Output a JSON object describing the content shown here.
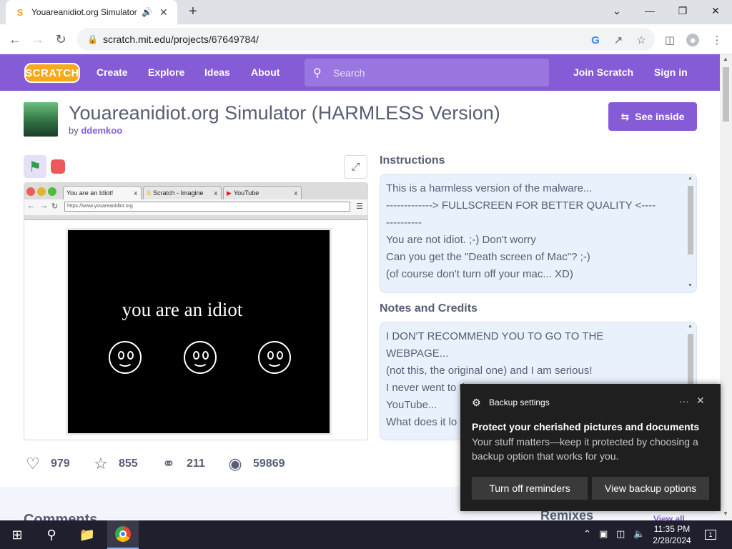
{
  "browser": {
    "tab_title": "Youareanidiot.org Simulator",
    "url": "scratch.mit.edu/projects/67649784/",
    "new_tab": "+"
  },
  "nav": {
    "logo": "SCRATCH",
    "links": [
      "Create",
      "Explore",
      "Ideas",
      "About"
    ],
    "search_placeholder": "Search",
    "join": "Join Scratch",
    "signin": "Sign in"
  },
  "project": {
    "title": "Youareanidiot.org Simulator (HARMLESS Version)",
    "by_label": "by",
    "author": "ddemkoo",
    "see_inside": "See inside"
  },
  "stage": {
    "tabs": [
      "You are an Idiot!",
      "Scratch - Imagine",
      "YouTube"
    ],
    "url": "https://www.youareanidiot.org",
    "message": "you are an idiot"
  },
  "instructions": {
    "heading": "Instructions",
    "lines": [
      "This is a harmless version of the malware...",
      "-------------> FULLSCREEN FOR BETTER QUALITY <----",
      "----------",
      "You are not idiot. ;-) Don't worry",
      "Can you get the \"Death screen of Mac\"? ;-)",
      "(of course don't turn off your mac... XD)"
    ]
  },
  "notes": {
    "heading": "Notes and Credits",
    "lines": [
      "I DON'T RECOMMEND YOU TO GO TO THE",
      "WEBPAGE...",
      "(not this, the original one) and I am serious!",
      "I never went to th",
      "YouTube...",
      "What does it lo"
    ]
  },
  "stats": {
    "loves": "979",
    "favorites": "855",
    "remixes": "211",
    "views": "59869"
  },
  "lower": {
    "comments": "Comments",
    "remixes": "Remixes",
    "view_all": "View all"
  },
  "toast": {
    "app": "Backup settings",
    "more": "···",
    "heading": "Protect your cherished pictures and documents",
    "body": "Your stuff matters—keep it protected by choosing a backup option that works for you.",
    "btn_off": "Turn off reminders",
    "btn_view": "View backup options"
  },
  "taskbar": {
    "time": "11:35 PM",
    "date": "2/28/2024",
    "notif_count": "1"
  },
  "colors": {
    "scratch_purple": "#855cd6",
    "scratch_orange": "#f7a81b",
    "toast_bg": "#1f1f1f"
  }
}
